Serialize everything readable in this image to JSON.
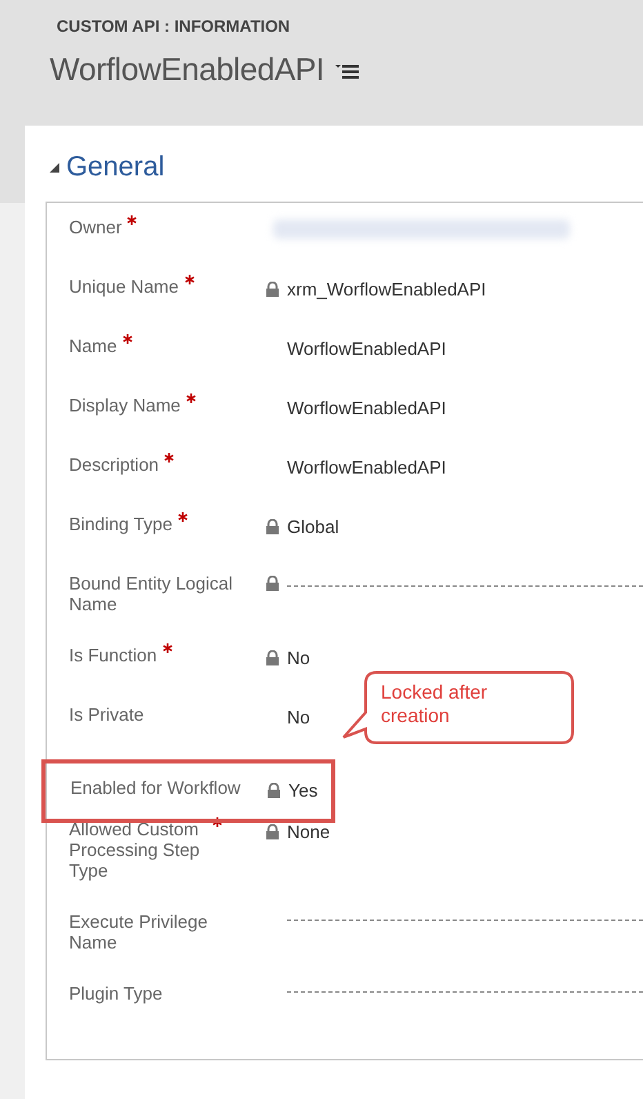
{
  "header": {
    "entity": "CUSTOM API : INFORMATION",
    "title": "WorflowEnabledAPI"
  },
  "section": {
    "title": "General",
    "expanded": true
  },
  "fields": [
    {
      "label": "Owner",
      "required": true,
      "locked": false,
      "kind": "redacted"
    },
    {
      "label": "Unique Name",
      "required": true,
      "locked": true,
      "kind": "text",
      "value": "xrm_WorflowEnabledAPI"
    },
    {
      "label": "Name",
      "required": true,
      "locked": false,
      "kind": "text",
      "value": "WorflowEnabledAPI"
    },
    {
      "label": "Display Name",
      "required": true,
      "locked": false,
      "kind": "text",
      "value": "WorflowEnabledAPI"
    },
    {
      "label": "Description",
      "required": true,
      "locked": false,
      "kind": "text",
      "value": "WorflowEnabledAPI"
    },
    {
      "label": "Binding Type",
      "required": true,
      "locked": true,
      "kind": "text",
      "value": "Global"
    },
    {
      "label": "Bound Entity Logical Name",
      "required": false,
      "locked": true,
      "kind": "empty"
    },
    {
      "label": "Is Function",
      "required": true,
      "locked": true,
      "kind": "text",
      "value": "No"
    },
    {
      "label": "Is Private",
      "required": false,
      "locked": false,
      "kind": "text",
      "value": "No"
    },
    {
      "label": "Enabled for Workflow",
      "required": false,
      "locked": true,
      "kind": "text",
      "value": "Yes",
      "highlighted": true
    },
    {
      "label": "Allowed Custom Processing Step Type",
      "required": true,
      "locked": true,
      "kind": "text",
      "value": "None"
    },
    {
      "label": "Execute Privilege Name",
      "required": false,
      "locked": false,
      "kind": "empty"
    },
    {
      "label": "Plugin Type",
      "required": false,
      "locked": false,
      "kind": "empty"
    }
  ],
  "callout": {
    "text": "Locked after creation"
  }
}
